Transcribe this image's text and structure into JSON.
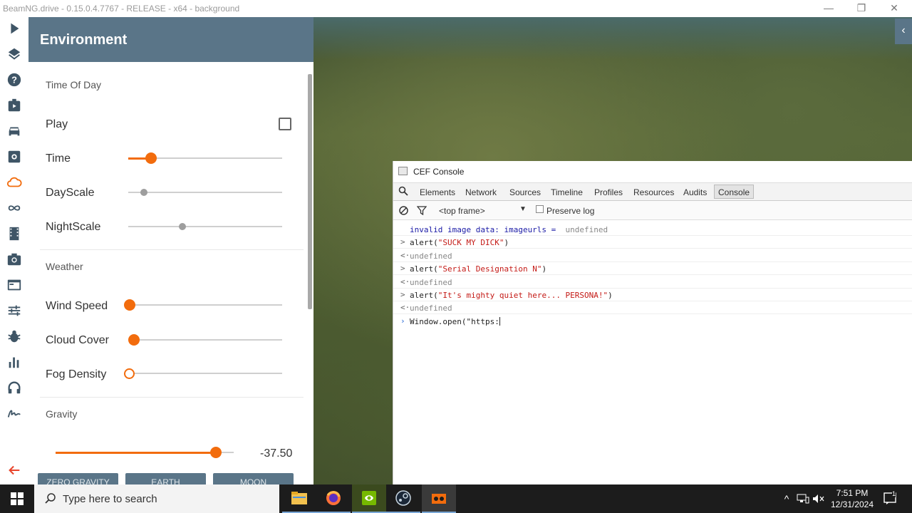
{
  "window": {
    "title": "BeamNG.drive - 0.15.0.4.7767 - RELEASE - x64 - background",
    "minimize": "—",
    "restore": "❐",
    "close": "✕"
  },
  "iconbar": {
    "icons": [
      "play-icon",
      "layers-icon",
      "help-icon",
      "media-icon",
      "car-icon",
      "vehicle-config-icon",
      "cloud-icon",
      "infinity-icon",
      "film-icon",
      "camera-icon",
      "browser-icon",
      "sliders-icon",
      "bug-icon",
      "chart-icon",
      "headphones-icon",
      "signature-icon",
      "back-arrow-icon"
    ],
    "active": "cloud-icon",
    "accent": "#f26c0d"
  },
  "environment": {
    "title": "Environment",
    "time_of_day": {
      "section": "Time Of Day",
      "play_label": "Play",
      "play_checked": false,
      "time_label": "Time",
      "time_value": 0.15,
      "dayscale_label": "DayScale",
      "dayscale_value": 0.1,
      "nightscale_label": "NightScale",
      "nightscale_value": 0.35
    },
    "weather": {
      "section": "Weather",
      "wind_label": "Wind Speed",
      "wind_value": 0.0,
      "cloud_label": "Cloud Cover",
      "cloud_value": 0.03,
      "fog_label": "Fog Density",
      "fog_value": 0.0
    },
    "gravity": {
      "section": "Gravity",
      "value": 0.9,
      "value_text": "-37.50",
      "buttons": [
        "ZERO GRAVITY",
        "EARTH",
        "MOON"
      ]
    }
  },
  "console": {
    "title": "CEF Console",
    "tabs": [
      "Elements",
      "Network",
      "Sources",
      "Timeline",
      "Profiles",
      "Resources",
      "Audits",
      "Console"
    ],
    "active_tab": "Console",
    "frame_select": "<top frame>",
    "preserve_log_label": "Preserve log",
    "lines": [
      {
        "mark": "",
        "parts": [
          {
            "t": "invalid image data: imageurls = ",
            "c": "c-blue"
          },
          {
            "t": " undefined",
            "c": "c-grey"
          }
        ]
      },
      {
        "mark": ">",
        "parts": [
          {
            "t": "alert(",
            "c": "c-black"
          },
          {
            "t": "\"SUCK MY DICK\"",
            "c": "c-red"
          },
          {
            "t": ")",
            "c": "c-black"
          }
        ]
      },
      {
        "mark": "<·",
        "parts": [
          {
            "t": "undefined",
            "c": "c-grey"
          }
        ]
      },
      {
        "mark": ">",
        "parts": [
          {
            "t": "alert(",
            "c": "c-black"
          },
          {
            "t": "\"Serial Designation N\"",
            "c": "c-red"
          },
          {
            "t": ")",
            "c": "c-black"
          }
        ]
      },
      {
        "mark": "<·",
        "parts": [
          {
            "t": "undefined",
            "c": "c-grey"
          }
        ]
      },
      {
        "mark": ">",
        "parts": [
          {
            "t": "alert(",
            "c": "c-black"
          },
          {
            "t": "\"It's mighty quiet here... PERSONA!\"",
            "c": "c-red"
          },
          {
            "t": ")",
            "c": "c-black"
          }
        ]
      },
      {
        "mark": "<·",
        "parts": [
          {
            "t": "undefined",
            "c": "c-grey"
          }
        ]
      }
    ],
    "input_text": "Window.open(\"https:"
  },
  "taskbar": {
    "search_placeholder": "Type here to search",
    "apps": [
      "file-explorer-icon",
      "firefox-icon",
      "nvidia-icon",
      "steam-icon",
      "beamng-icon"
    ],
    "time": "7:51 PM",
    "date": "12/31/2024",
    "notification_count": "1"
  }
}
